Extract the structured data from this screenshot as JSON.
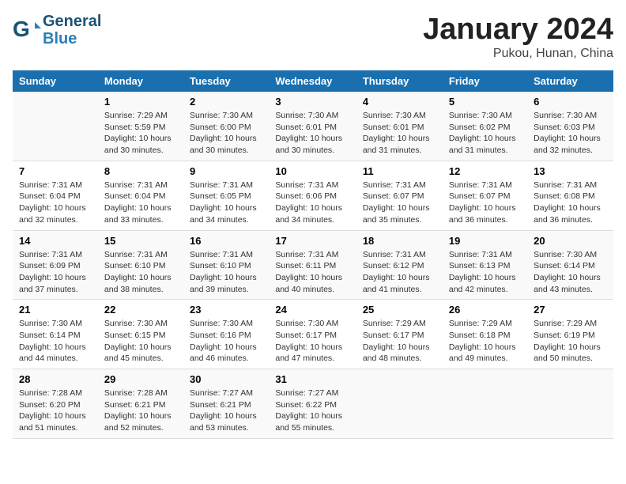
{
  "header": {
    "logo_line1": "General",
    "logo_line2": "Blue",
    "month": "January 2024",
    "location": "Pukou, Hunan, China"
  },
  "weekdays": [
    "Sunday",
    "Monday",
    "Tuesday",
    "Wednesday",
    "Thursday",
    "Friday",
    "Saturday"
  ],
  "weeks": [
    [
      {
        "day": "",
        "sunrise": "",
        "sunset": "",
        "daylight": ""
      },
      {
        "day": "1",
        "sunrise": "Sunrise: 7:29 AM",
        "sunset": "Sunset: 5:59 PM",
        "daylight": "Daylight: 10 hours and 30 minutes."
      },
      {
        "day": "2",
        "sunrise": "Sunrise: 7:30 AM",
        "sunset": "Sunset: 6:00 PM",
        "daylight": "Daylight: 10 hours and 30 minutes."
      },
      {
        "day": "3",
        "sunrise": "Sunrise: 7:30 AM",
        "sunset": "Sunset: 6:01 PM",
        "daylight": "Daylight: 10 hours and 30 minutes."
      },
      {
        "day": "4",
        "sunrise": "Sunrise: 7:30 AM",
        "sunset": "Sunset: 6:01 PM",
        "daylight": "Daylight: 10 hours and 31 minutes."
      },
      {
        "day": "5",
        "sunrise": "Sunrise: 7:30 AM",
        "sunset": "Sunset: 6:02 PM",
        "daylight": "Daylight: 10 hours and 31 minutes."
      },
      {
        "day": "6",
        "sunrise": "Sunrise: 7:30 AM",
        "sunset": "Sunset: 6:03 PM",
        "daylight": "Daylight: 10 hours and 32 minutes."
      }
    ],
    [
      {
        "day": "7",
        "sunrise": "Sunrise: 7:31 AM",
        "sunset": "Sunset: 6:04 PM",
        "daylight": "Daylight: 10 hours and 32 minutes."
      },
      {
        "day": "8",
        "sunrise": "Sunrise: 7:31 AM",
        "sunset": "Sunset: 6:04 PM",
        "daylight": "Daylight: 10 hours and 33 minutes."
      },
      {
        "day": "9",
        "sunrise": "Sunrise: 7:31 AM",
        "sunset": "Sunset: 6:05 PM",
        "daylight": "Daylight: 10 hours and 34 minutes."
      },
      {
        "day": "10",
        "sunrise": "Sunrise: 7:31 AM",
        "sunset": "Sunset: 6:06 PM",
        "daylight": "Daylight: 10 hours and 34 minutes."
      },
      {
        "day": "11",
        "sunrise": "Sunrise: 7:31 AM",
        "sunset": "Sunset: 6:07 PM",
        "daylight": "Daylight: 10 hours and 35 minutes."
      },
      {
        "day": "12",
        "sunrise": "Sunrise: 7:31 AM",
        "sunset": "Sunset: 6:07 PM",
        "daylight": "Daylight: 10 hours and 36 minutes."
      },
      {
        "day": "13",
        "sunrise": "Sunrise: 7:31 AM",
        "sunset": "Sunset: 6:08 PM",
        "daylight": "Daylight: 10 hours and 36 minutes."
      }
    ],
    [
      {
        "day": "14",
        "sunrise": "Sunrise: 7:31 AM",
        "sunset": "Sunset: 6:09 PM",
        "daylight": "Daylight: 10 hours and 37 minutes."
      },
      {
        "day": "15",
        "sunrise": "Sunrise: 7:31 AM",
        "sunset": "Sunset: 6:10 PM",
        "daylight": "Daylight: 10 hours and 38 minutes."
      },
      {
        "day": "16",
        "sunrise": "Sunrise: 7:31 AM",
        "sunset": "Sunset: 6:10 PM",
        "daylight": "Daylight: 10 hours and 39 minutes."
      },
      {
        "day": "17",
        "sunrise": "Sunrise: 7:31 AM",
        "sunset": "Sunset: 6:11 PM",
        "daylight": "Daylight: 10 hours and 40 minutes."
      },
      {
        "day": "18",
        "sunrise": "Sunrise: 7:31 AM",
        "sunset": "Sunset: 6:12 PM",
        "daylight": "Daylight: 10 hours and 41 minutes."
      },
      {
        "day": "19",
        "sunrise": "Sunrise: 7:31 AM",
        "sunset": "Sunset: 6:13 PM",
        "daylight": "Daylight: 10 hours and 42 minutes."
      },
      {
        "day": "20",
        "sunrise": "Sunrise: 7:30 AM",
        "sunset": "Sunset: 6:14 PM",
        "daylight": "Daylight: 10 hours and 43 minutes."
      }
    ],
    [
      {
        "day": "21",
        "sunrise": "Sunrise: 7:30 AM",
        "sunset": "Sunset: 6:14 PM",
        "daylight": "Daylight: 10 hours and 44 minutes."
      },
      {
        "day": "22",
        "sunrise": "Sunrise: 7:30 AM",
        "sunset": "Sunset: 6:15 PM",
        "daylight": "Daylight: 10 hours and 45 minutes."
      },
      {
        "day": "23",
        "sunrise": "Sunrise: 7:30 AM",
        "sunset": "Sunset: 6:16 PM",
        "daylight": "Daylight: 10 hours and 46 minutes."
      },
      {
        "day": "24",
        "sunrise": "Sunrise: 7:30 AM",
        "sunset": "Sunset: 6:17 PM",
        "daylight": "Daylight: 10 hours and 47 minutes."
      },
      {
        "day": "25",
        "sunrise": "Sunrise: 7:29 AM",
        "sunset": "Sunset: 6:17 PM",
        "daylight": "Daylight: 10 hours and 48 minutes."
      },
      {
        "day": "26",
        "sunrise": "Sunrise: 7:29 AM",
        "sunset": "Sunset: 6:18 PM",
        "daylight": "Daylight: 10 hours and 49 minutes."
      },
      {
        "day": "27",
        "sunrise": "Sunrise: 7:29 AM",
        "sunset": "Sunset: 6:19 PM",
        "daylight": "Daylight: 10 hours and 50 minutes."
      }
    ],
    [
      {
        "day": "28",
        "sunrise": "Sunrise: 7:28 AM",
        "sunset": "Sunset: 6:20 PM",
        "daylight": "Daylight: 10 hours and 51 minutes."
      },
      {
        "day": "29",
        "sunrise": "Sunrise: 7:28 AM",
        "sunset": "Sunset: 6:21 PM",
        "daylight": "Daylight: 10 hours and 52 minutes."
      },
      {
        "day": "30",
        "sunrise": "Sunrise: 7:27 AM",
        "sunset": "Sunset: 6:21 PM",
        "daylight": "Daylight: 10 hours and 53 minutes."
      },
      {
        "day": "31",
        "sunrise": "Sunrise: 7:27 AM",
        "sunset": "Sunset: 6:22 PM",
        "daylight": "Daylight: 10 hours and 55 minutes."
      },
      {
        "day": "",
        "sunrise": "",
        "sunset": "",
        "daylight": ""
      },
      {
        "day": "",
        "sunrise": "",
        "sunset": "",
        "daylight": ""
      },
      {
        "day": "",
        "sunrise": "",
        "sunset": "",
        "daylight": ""
      }
    ]
  ]
}
